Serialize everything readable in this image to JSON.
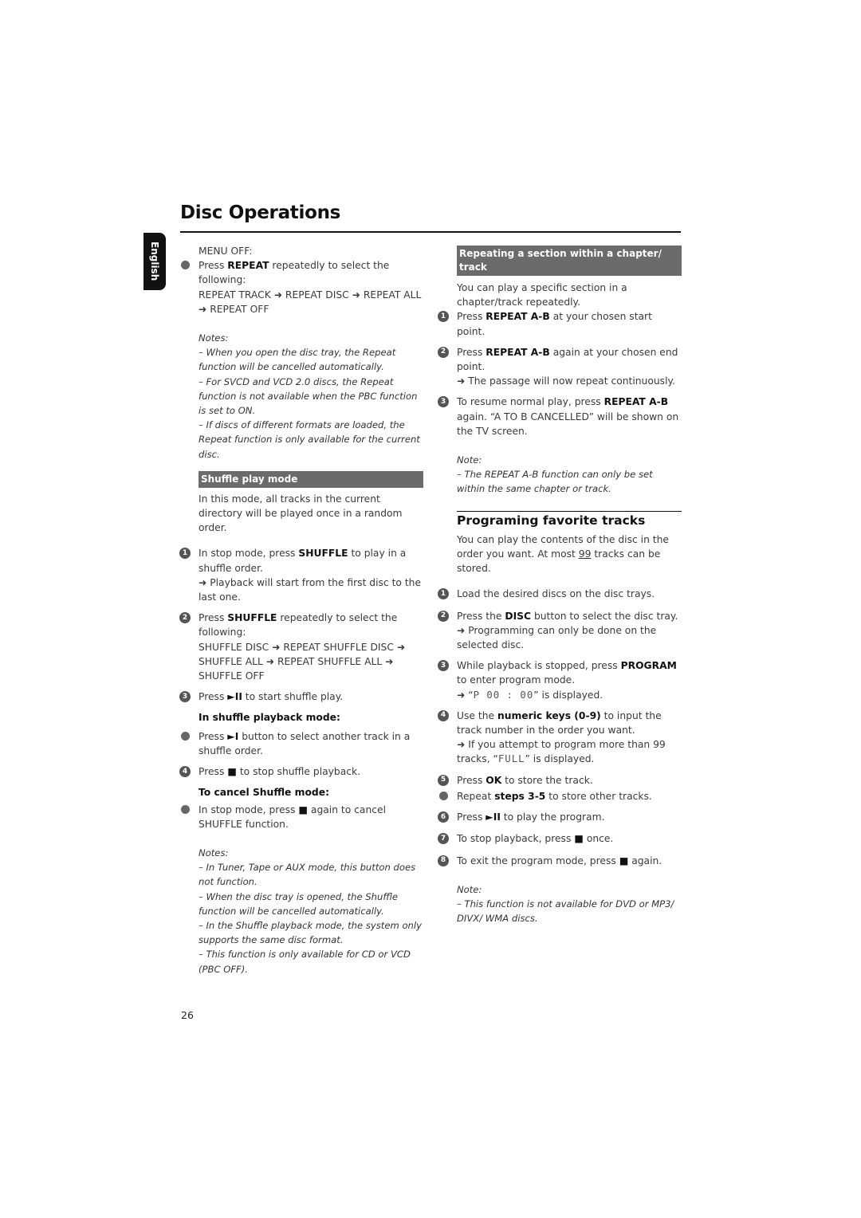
{
  "page": {
    "title": "Disc Operations",
    "language_tab": "English",
    "page_number": "26"
  },
  "left_column": {
    "menu_off": "MENU OFF:",
    "repeat_bullet": {
      "pre": "Press ",
      "key": "REPEAT",
      "post": " repeatedly to select the following:",
      "sequence": "REPEAT TRACK ➜ REPEAT DISC ➜ REPEAT ALL ➜ REPEAT OFF"
    },
    "notes_label": "Notes:",
    "repeat_notes": [
      "–  When you open the disc tray, the Repeat function will be cancelled automatically.",
      "–  For SVCD and VCD 2.0 discs, the Repeat function is not available when the PBC function is set to ON.",
      "–  If discs of different formats are loaded, the Repeat function is only available for the current disc."
    ],
    "shuffle_section": {
      "heading": "Shuffle play mode",
      "intro": "In this mode, all tracks in the current directory will be played once in a random order.",
      "step1": {
        "num": "1",
        "pre": "In stop mode, press ",
        "key": "SHUFFLE",
        "post": " to play in a shuffle order.",
        "result": "➜ Playback will start from the first disc to the last one."
      },
      "step2": {
        "num": "2",
        "pre": "Press ",
        "key": "SHUFFLE",
        "post": " repeatedly to select the following:",
        "sequence": "SHUFFLE DISC ➜ REPEAT SHUFFLE DISC ➜ SHUFFLE ALL ➜ REPEAT SHUFFLE ALL ➜ SHUFFLE OFF"
      },
      "step3": {
        "num": "3",
        "pre": "Press ",
        "key": "►II",
        "post": " to start shuffle play."
      },
      "playback_mode_heading": "In shuffle playback mode:",
      "next_bullet": {
        "pre": "Press ",
        "key": "►I",
        "post": " button to select another track in a shuffle order."
      },
      "step4": {
        "num": "4",
        "pre": "Press ",
        "key": "■",
        "post": " to stop shuffle playback."
      },
      "cancel_heading": "To cancel Shuffle mode:",
      "cancel_bullet": {
        "pre": "In stop mode, press ",
        "key": "■",
        "post": " again to cancel SHUFFLE function."
      },
      "notes_label": "Notes:",
      "notes": [
        "–  In Tuner, Tape or AUX mode, this button does not function.",
        "–  When the disc tray is opened, the Shuffle function will be cancelled automatically.",
        "–  In the Shuffle playback mode, the system only supports the same disc format.",
        "–  This function is only available for CD or VCD (PBC OFF)."
      ]
    }
  },
  "right_column": {
    "ab_section": {
      "heading": "Repeating a section within a chapter/ track",
      "intro": "You can play a specific section in a chapter/track repeatedly.",
      "step1": {
        "num": "1",
        "pre": "Press ",
        "key": "REPEAT A-B",
        "post": " at your chosen start point."
      },
      "step2": {
        "num": "2",
        "pre": "Press ",
        "key": "REPEAT A-B",
        "post": " again at your chosen end point.",
        "result": "➜ The passage will now repeat continuously."
      },
      "step3": {
        "num": "3",
        "pre": "To resume normal play, press ",
        "key": "REPEAT A-B",
        "post": " again. “A TO B CANCELLED” will be shown on the TV screen."
      },
      "note_label": "Note:",
      "note": "–  The REPEAT A-B function can only be set within the same chapter or track."
    },
    "program_section": {
      "heading": "Programing favorite tracks",
      "intro_pre": "You can play the contents of the disc in the order you want. At most ",
      "intro_num": "99",
      "intro_post": " tracks can be stored.",
      "step1": {
        "num": "1",
        "text": "Load the desired discs on the disc trays."
      },
      "step2": {
        "num": "2",
        "pre": "Press the ",
        "key": "DISC",
        "post": " button to select the disc tray.",
        "result": "➜ Programming can only be done on the selected disc."
      },
      "step3": {
        "num": "3",
        "pre": "While playback is stopped, press ",
        "key": "PROGRAM",
        "post": " to enter program mode.",
        "result_pre": "➜ “",
        "result_lcd": "P 00 : 00",
        "result_post": "” is displayed."
      },
      "step4": {
        "num": "4",
        "pre": "Use the ",
        "key": "numeric keys (0-9)",
        "post": " to input the track number in the order you want.",
        "result_pre": "➜ If you attempt to program more than 99 tracks, “",
        "result_lcd": "FULL",
        "result_post": "” is displayed."
      },
      "step5": {
        "num": "5",
        "pre": "Press ",
        "key": "OK",
        "post": " to store the track."
      },
      "repeat_bullet": {
        "pre": "Repeat ",
        "key": "steps 3-5",
        "post": " to store other tracks."
      },
      "step6": {
        "num": "6",
        "pre": "Press ",
        "key": "►II",
        "post": " to play the program."
      },
      "step7": {
        "num": "7",
        "pre": "To stop playback, press ",
        "key": "■",
        "post": " once."
      },
      "step8": {
        "num": "8",
        "pre": "To exit the program mode, press ",
        "key": "■",
        "post": " again."
      },
      "note_label": "Note:",
      "note": "–  This function is not available for DVD or MP3/ DIVX/ WMA discs."
    }
  }
}
